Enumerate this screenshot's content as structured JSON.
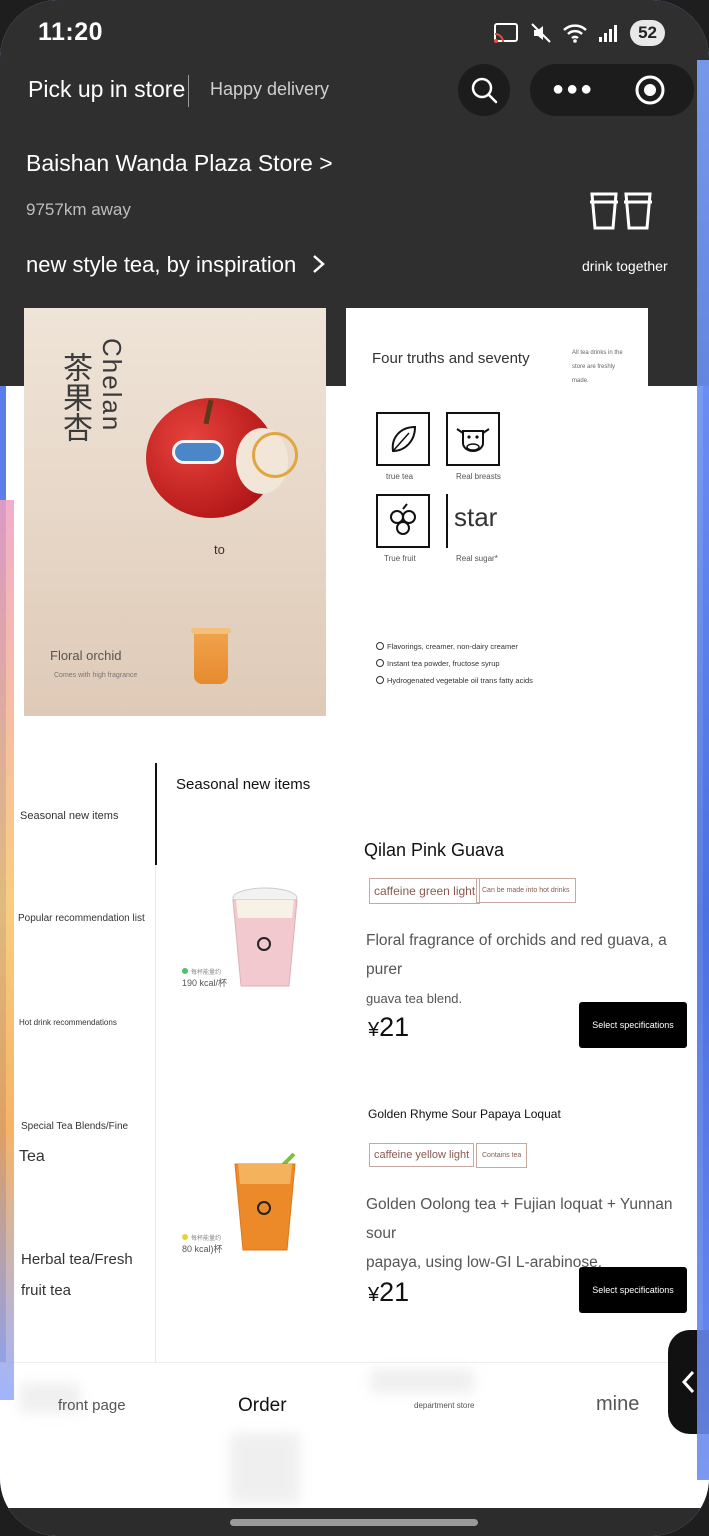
{
  "status": {
    "time": "11:20",
    "battery": "52"
  },
  "header": {
    "pickup_label": "Pick up in store",
    "delivery_label": "Happy delivery"
  },
  "store": {
    "name": "Baishan Wanda Plaza Store >",
    "distance": "9757km away",
    "slogan": "new style tea, by inspiration",
    "drink_together": "drink together"
  },
  "banner1": {
    "title": "Chelan",
    "title_cn": "茶果杏",
    "to_text": "to",
    "floral": "Floral orchid",
    "sub": "Comes with high fragrance"
  },
  "banner2": {
    "title": "Four truths and seventy",
    "note": "All tea drinks in the store are freshly made.",
    "icons": [
      "true tea",
      "Real breasts",
      "True fruit",
      "Real sugar*"
    ],
    "star_text": "star",
    "checks": [
      "Flavorings, creamer, non-dairy creamer",
      "Instant tea powder, fructose syrup",
      "Hydrogenated vegetable oil trans fatty acids"
    ]
  },
  "sidebar": {
    "items": [
      "Seasonal new items",
      "Popular recommendation list",
      "Hot drink recommendations",
      "Special Tea Blends/Fine",
      "Tea",
      "Herbal tea/Fresh",
      "fruit tea"
    ]
  },
  "menu": {
    "section_title": "Seasonal new items",
    "products": [
      {
        "name": "Qilan Pink Guava",
        "tag1": "caffeine green light",
        "tag2": "Can be made into hot drinks",
        "desc_line1": "Floral fragrance of orchids and red guava, a purer",
        "desc_line2": "guava tea blend.",
        "currency": "¥",
        "price": "21",
        "button": "Select specifications",
        "kcal_label": "每杯能量约",
        "kcal": "190 kcal/杯"
      },
      {
        "name": "Golden Rhyme Sour Papaya Loquat",
        "tag1": "caffeine yellow light",
        "tag2": "Contains tea",
        "desc_line1": "Golden Oolong tea + Fujian loquat + Yunnan sour",
        "desc_line2": "papaya, using low-GI L-arabinose.",
        "currency": "¥",
        "price": "21",
        "button": "Select specifications",
        "kcal_label": "每杯能量约",
        "kcal": "80 kcal)杯"
      }
    ]
  },
  "tabbar": {
    "items": [
      "front page",
      "Order",
      "department store",
      "mine"
    ]
  },
  "colors": {
    "header_bg": "#2f2f2f",
    "button_bg": "#000000",
    "tag_border": "#c8a8a0",
    "green_dot": "#4cc26a",
    "yellow_dot": "#e8d23c"
  }
}
